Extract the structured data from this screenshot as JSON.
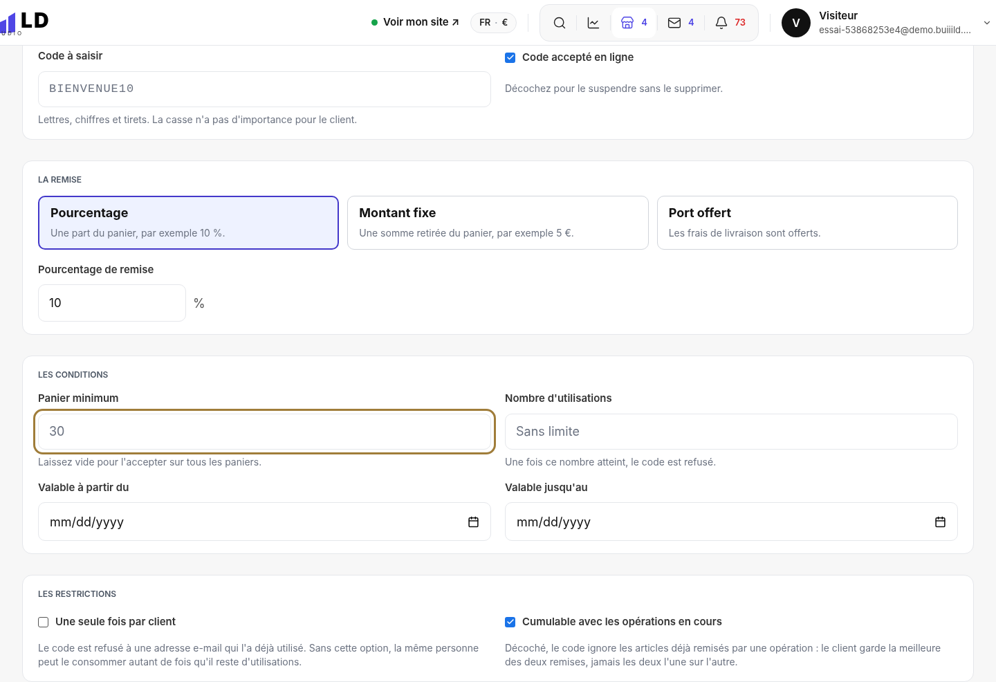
{
  "header": {
    "logo": {
      "mark": "LD",
      "sub": "UDIO"
    },
    "site_link": {
      "label": "Voir mon site ↗",
      "online": true
    },
    "locale": {
      "language": "FR",
      "separator": "·",
      "currency": "€"
    },
    "nav": [
      {
        "kind": "search",
        "selected": false
      },
      {
        "kind": "stats",
        "selected": false
      },
      {
        "kind": "store",
        "count": "4",
        "selected": true
      },
      {
        "kind": "mail",
        "count": "4",
        "selected": false
      },
      {
        "kind": "bell",
        "count": "73",
        "selected": false
      }
    ],
    "user": {
      "initial": "V",
      "name": "Visiteur",
      "email": "essai-53868253e4@demo.buiiild...."
    }
  },
  "code_section": {
    "label": "Code à saisir",
    "field": {
      "placeholder": "BIENVENUE10"
    },
    "hint": "Lettres, chiffres et tirets. La casse n'a pas d'importance pour le client.",
    "online": {
      "label": "Code accepté en ligne",
      "checked": true,
      "hint": "Décochez pour le suspendre sans le supprimer."
    }
  },
  "discount_section": {
    "title": "LA REMISE",
    "options": [
      {
        "title": "Pourcentage",
        "description": "Une part du panier, par exemple 10 %.",
        "selected": true
      },
      {
        "title": "Montant fixe",
        "description": "Une somme retirée du panier, par exemple 5 €.",
        "selected": false
      },
      {
        "title": "Port offert",
        "description": "Les frais de livraison sont offerts.",
        "selected": false
      }
    ],
    "amount": {
      "label": "Pourcentage de remise",
      "value": "10",
      "unit": "%"
    }
  },
  "conditions_section": {
    "title": "LES CONDITIONS",
    "fields": [
      {
        "kind": "text",
        "label": "Panier minimum",
        "placeholder": "30",
        "hint": "Laissez vide pour l'accepter sur tous les paniers.",
        "focused": true
      },
      {
        "kind": "text",
        "label": "Nombre d'utilisations",
        "placeholder": "Sans limite",
        "hint": "Une fois ce nombre atteint, le code est refusé.",
        "focused": false
      },
      {
        "kind": "date",
        "label": "Valable à partir du",
        "placeholder": "mm/dd/yyyy",
        "focused": false
      },
      {
        "kind": "date",
        "label": "Valable jusqu'au",
        "placeholder": "mm/dd/yyyy",
        "focused": false
      }
    ]
  },
  "restrictions_section": {
    "title": "LES RESTRICTIONS",
    "options": [
      {
        "label": "Une seule fois par client",
        "checked": false,
        "hint": "Le code est refusé à une adresse e-mail qui l'a déjà utilisé. Sans cette option, la même personne peut le consommer autant de fois qu'il reste d'utilisations."
      },
      {
        "label": "Cumulable avec les opérations en cours",
        "checked": true,
        "hint": "Décoché, le code ignore les articles déjà remisés par une opération : le client garde la meilleure des deux remises, jamais les deux l'une sur l'autre."
      }
    ]
  }
}
